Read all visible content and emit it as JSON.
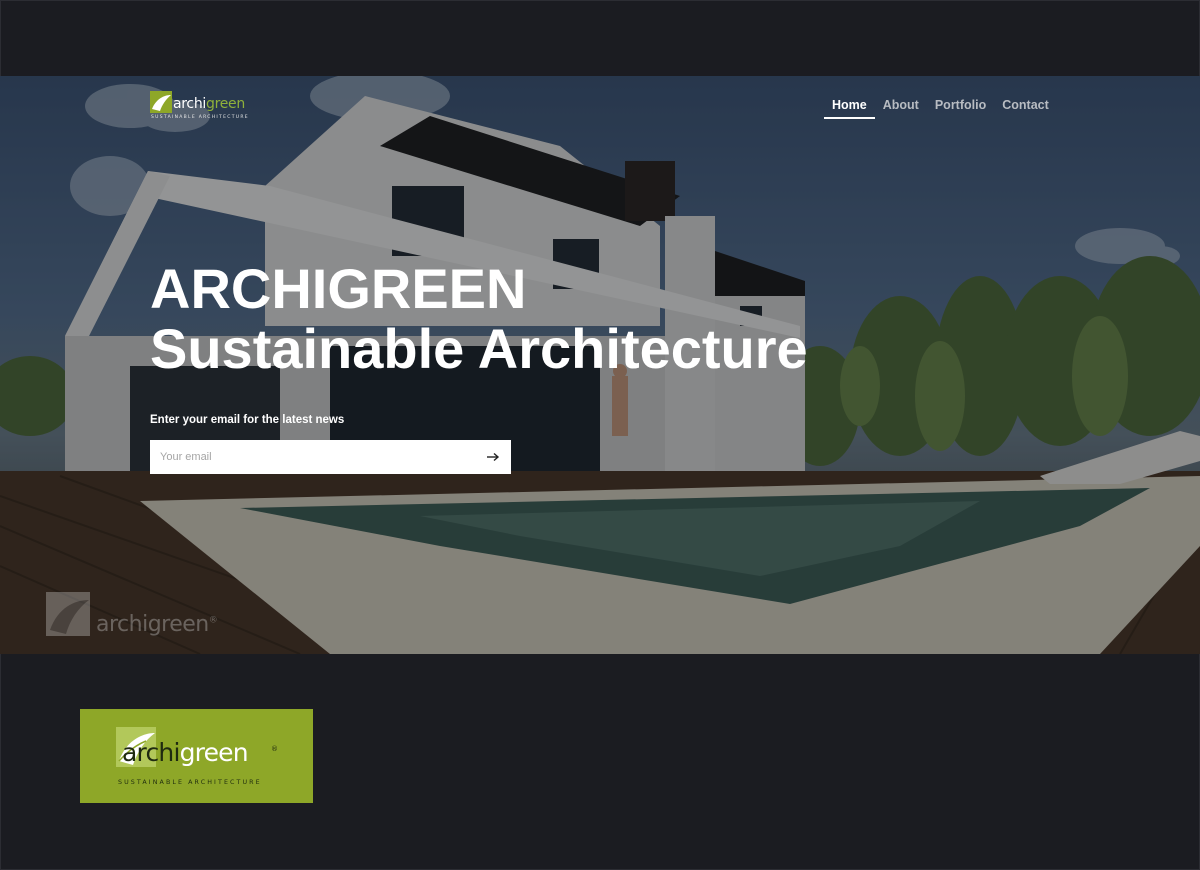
{
  "brand": {
    "wordmark_dark": "archi",
    "wordmark_accent": "green",
    "tagline": "SUSTAINABLE ARCHITECTURE",
    "registered": "®",
    "accent_color": "#8ea728"
  },
  "nav": {
    "items": [
      {
        "label": "Home",
        "active": true
      },
      {
        "label": "About",
        "active": false
      },
      {
        "label": "Portfolio",
        "active": false
      },
      {
        "label": "Contact",
        "active": false
      }
    ]
  },
  "hero": {
    "title_line1": "ARCHIGREEN",
    "title_line2": "Sustainable Architecture",
    "subscribe_label": "Enter your email for the latest news",
    "email_placeholder": "Your email",
    "submit_icon": "arrow-right-icon"
  },
  "watermark": {
    "wordmark": "archigreen",
    "registered": "®"
  }
}
